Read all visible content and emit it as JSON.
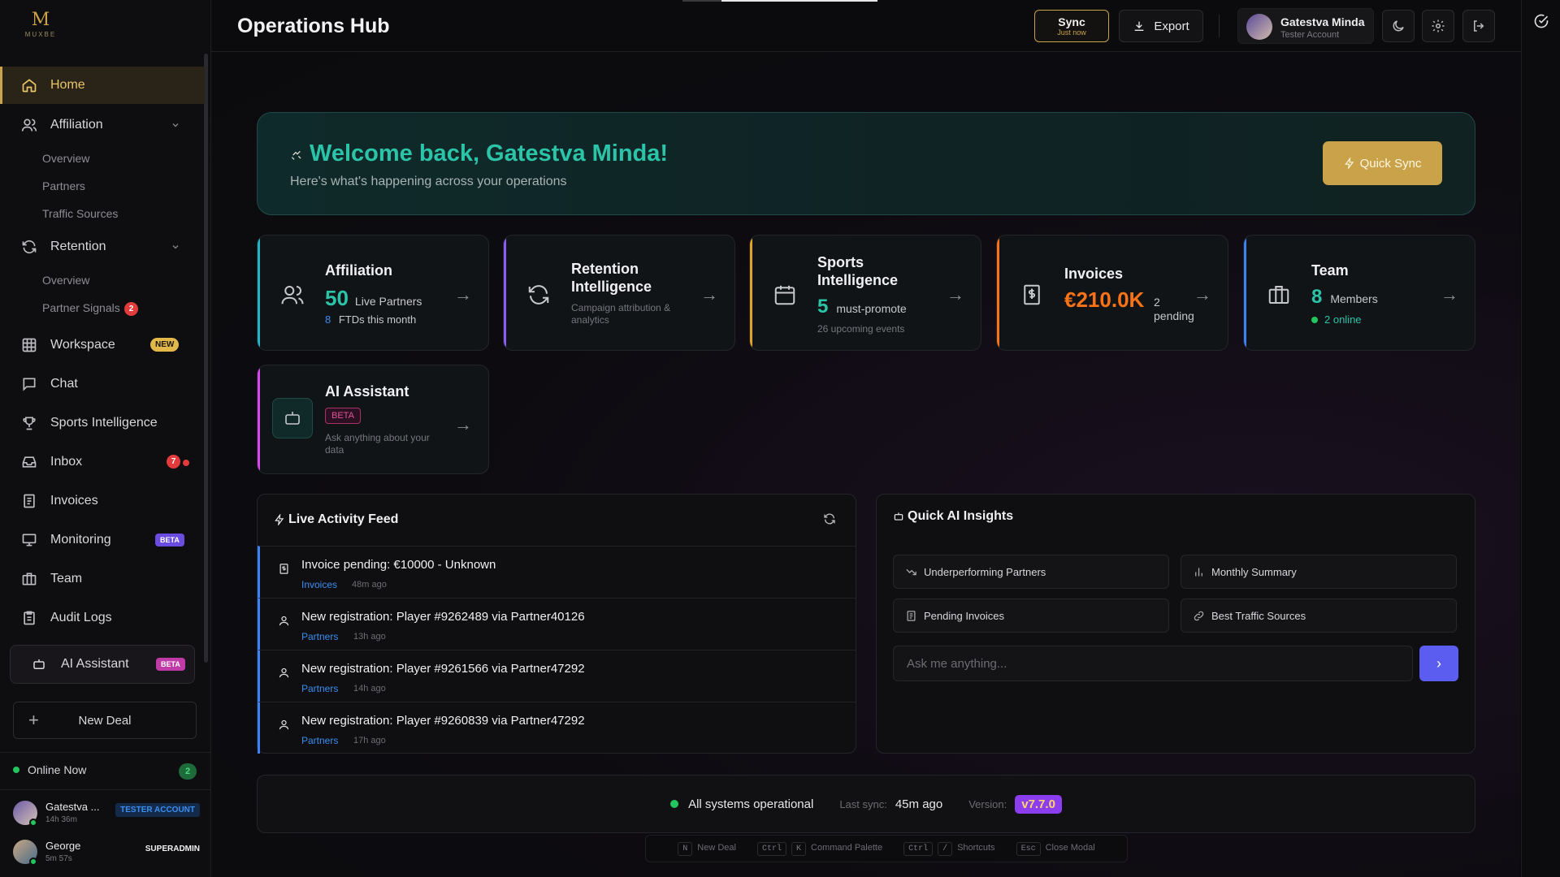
{
  "app": {
    "logo_text": "MUXBE",
    "title": "Operations Hub"
  },
  "colors": {
    "accent": "#c9a24a",
    "teal": "#2bc4a8",
    "blue": "#3b82f6",
    "purple": "#8b5cf6",
    "orange": "#f97316",
    "green": "#22c55e"
  },
  "sidebar": {
    "items": [
      {
        "label": "Home",
        "icon": "home-icon"
      },
      {
        "label": "Affiliation",
        "icon": "users-icon"
      },
      {
        "label": "Retention",
        "icon": "refresh-icon"
      },
      {
        "label": "Workspace",
        "icon": "grid-icon",
        "badge": "NEW"
      },
      {
        "label": "Chat",
        "icon": "chat-icon"
      },
      {
        "label": "Sports Intelligence",
        "icon": "trophy-icon"
      },
      {
        "label": "Inbox",
        "icon": "inbox-icon",
        "count": "7"
      },
      {
        "label": "Invoices",
        "icon": "invoice-icon"
      },
      {
        "label": "Monitoring",
        "icon": "monitor-icon",
        "badge": "BETA"
      },
      {
        "label": "Team",
        "icon": "briefcase-icon"
      },
      {
        "label": "Audit Logs",
        "icon": "clipboard-icon"
      }
    ],
    "affiliation_sub": [
      "Overview",
      "Partners",
      "Traffic Sources"
    ],
    "retention_sub": [
      "Overview",
      "Partner Signals"
    ],
    "partner_signals_count": "2",
    "ai_assistant": {
      "label": "AI Assistant",
      "badge": "BETA"
    },
    "new_deal": "New Deal",
    "online_now": "Online Now",
    "online_count": "2",
    "users": [
      {
        "name": "Gatestva ...",
        "time": "14h 36m",
        "role": "TESTER ACCOUNT"
      },
      {
        "name": "George",
        "time": "5m 57s",
        "role": "SUPERADMIN"
      }
    ]
  },
  "topbar": {
    "sync_label": "Sync",
    "sync_sub": "Just now",
    "export_label": "Export",
    "user_name": "Gatestva Minda",
    "user_role": "Tester Account"
  },
  "welcome": {
    "title": "Welcome back, Gatestva Minda!",
    "subtitle": "Here's what's happening across your operations",
    "quick_sync": "Quick Sync"
  },
  "cards": {
    "affiliation": {
      "title": "Affiliation",
      "value": "50",
      "value_label": "Live Partners",
      "sub_value": "8",
      "sub_label": "FTDs this month"
    },
    "retention": {
      "title": "Retention Intelligence",
      "desc": "Campaign attribution & analytics"
    },
    "sports": {
      "title": "Sports Intelligence",
      "value": "5",
      "value_label": "must-promote",
      "sub": "26 upcoming events"
    },
    "invoices": {
      "title": "Invoices",
      "value": "€210.0K",
      "sub": "2 pending"
    },
    "team": {
      "title": "Team",
      "value": "8",
      "value_label": "Members",
      "online": "2 online"
    },
    "ai": {
      "title": "AI Assistant",
      "badge": "BETA",
      "desc": "Ask anything about your data"
    }
  },
  "feed": {
    "title": "Live Activity Feed",
    "items": [
      {
        "text": "Invoice pending: €10000 - Unknown",
        "category": "Invoices",
        "ago": "48m ago",
        "icon": "invoice-icon"
      },
      {
        "text": "New registration: Player #9262489 via Partner40126",
        "category": "Partners",
        "ago": "13h ago",
        "icon": "user-icon"
      },
      {
        "text": "New registration: Player #9261566 via Partner47292",
        "category": "Partners",
        "ago": "14h ago",
        "icon": "user-icon"
      },
      {
        "text": "New registration: Player #9260839 via Partner47292",
        "category": "Partners",
        "ago": "17h ago",
        "icon": "user-icon"
      }
    ]
  },
  "insights": {
    "title": "Quick AI Insights",
    "buttons": [
      "Underperforming Partners",
      "Monthly Summary",
      "Pending Invoices",
      "Best Traffic Sources"
    ],
    "placeholder": "Ask me anything..."
  },
  "status": {
    "operational": "All systems operational",
    "last_sync_label": "Last sync:",
    "last_sync_value": "45m ago",
    "version_label": "Version:",
    "version_value": "v7.7.0"
  },
  "shortcuts": [
    {
      "keys": [
        "N"
      ],
      "label": "New Deal"
    },
    {
      "keys": [
        "Ctrl",
        "K"
      ],
      "label": "Command Palette"
    },
    {
      "keys": [
        "Ctrl",
        "/"
      ],
      "label": "Shortcuts"
    },
    {
      "keys": [
        "Esc"
      ],
      "label": "Close Modal"
    }
  ]
}
